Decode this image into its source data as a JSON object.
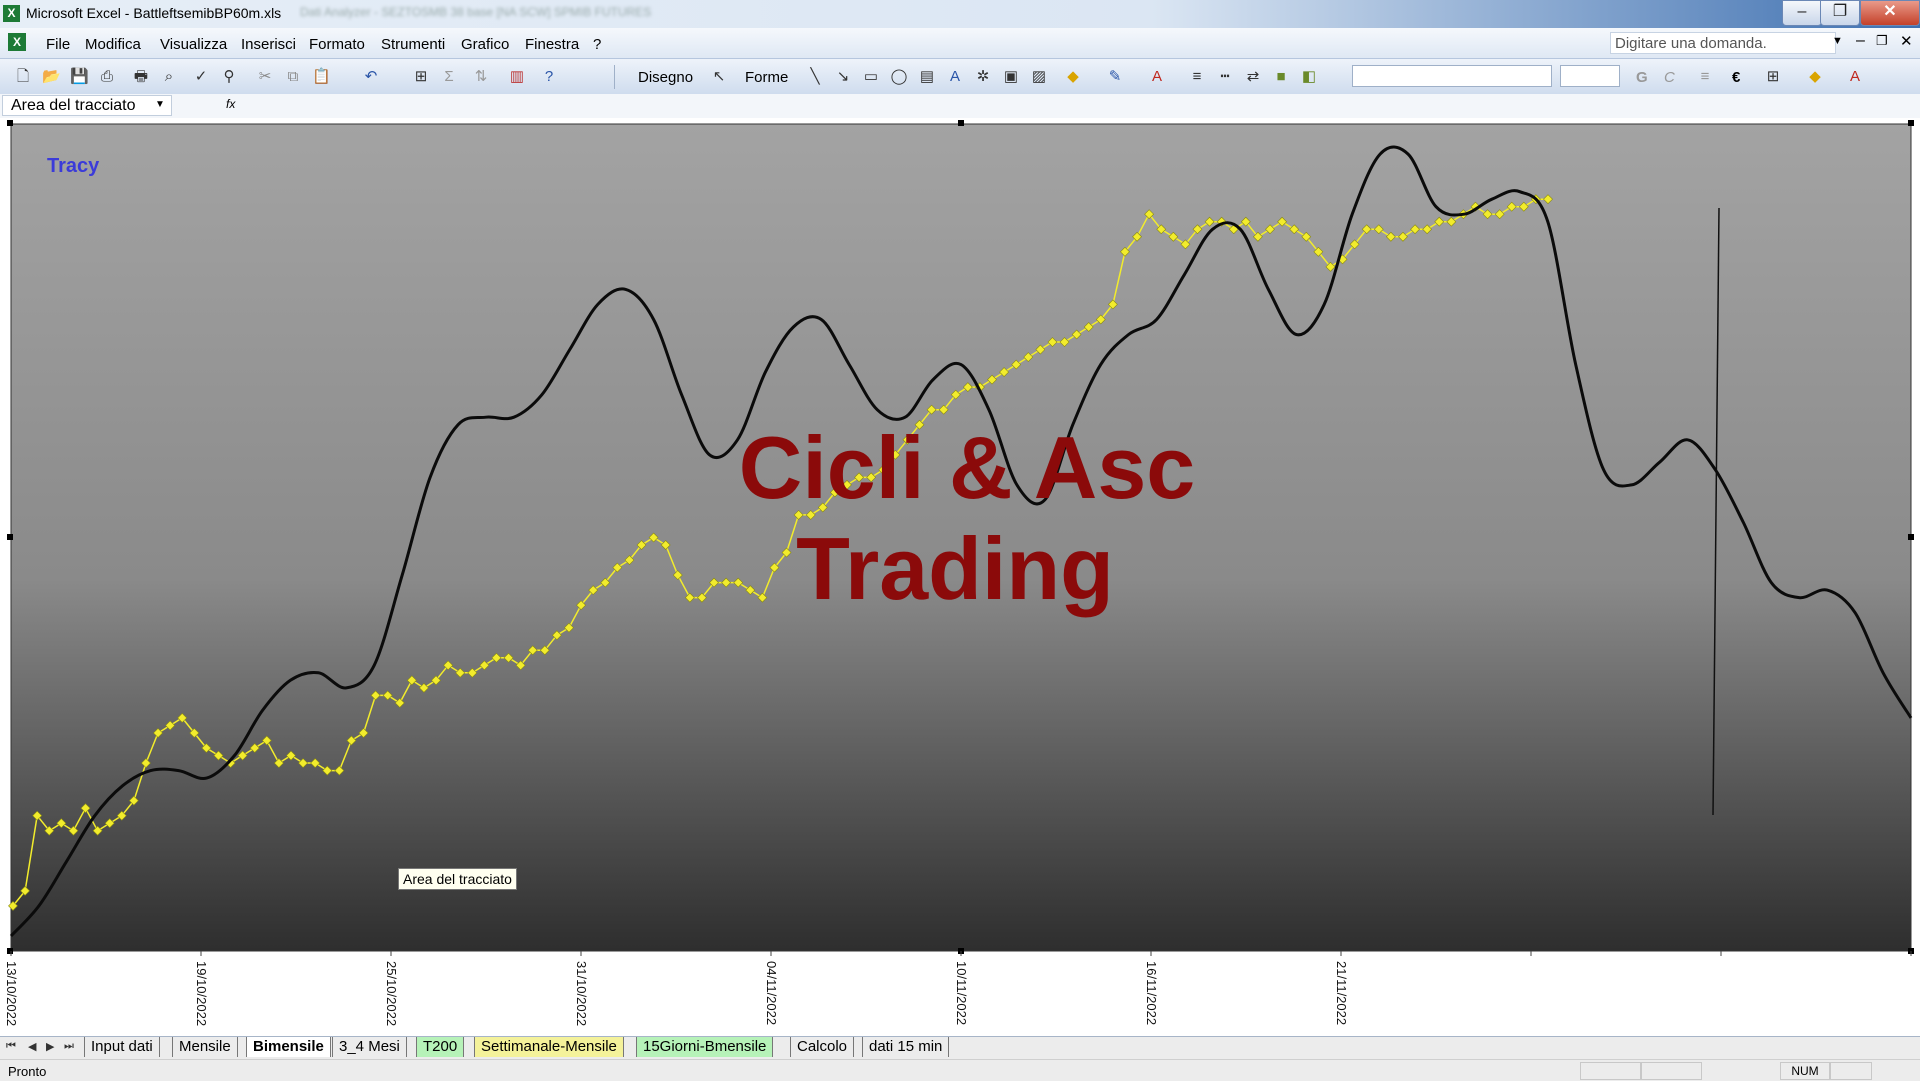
{
  "window": {
    "title": "Microsoft Excel - BattleftsemibBP60m.xls",
    "blurred_title_suffix": "Dati Analyzer - SEZTOSMB 38 base [NA SCW] SPMIB FUTURES",
    "minimize": "–",
    "restore": "❐",
    "close": "✕"
  },
  "menu": {
    "items": [
      "File",
      "Modifica",
      "Visualizza",
      "Inserisci",
      "Formato",
      "Strumenti",
      "Grafico",
      "Finestra",
      "?"
    ],
    "help_placeholder": "Digitare una domanda."
  },
  "toolbar": {
    "disegno_label": "Disegno",
    "forme_label": "Forme",
    "bold_label": "G",
    "italic_label": "C",
    "euro_label": "€"
  },
  "formula_bar": {
    "name_box": "Area del tracciato",
    "fx": "fx"
  },
  "chart": {
    "tooltip": "Area del tracciato",
    "tracy_label": "Tracy",
    "watermark_line1": "Cicli & Asc",
    "watermark_line2": "Trading",
    "colors": {
      "background_top": "#a3a3a3",
      "background_bottom": "#2e2e2e",
      "price_line": "#f2ec2c",
      "cycle_line": "#0b0b0b",
      "watermark": "#8b0a0a",
      "tracy": "#3b3bd9"
    }
  },
  "chart_data": {
    "type": "line",
    "x_tick_labels": [
      "13/10/2022",
      "19/10/2022",
      "25/10/2022",
      "31/10/2022",
      "04/11/2022",
      "10/11/2022",
      "16/11/2022",
      "21/11/2022",
      "",
      ""
    ],
    "series": [
      {
        "name": "Tracy",
        "style": "yellow line with diamond markers",
        "values": [
          6,
          8,
          18,
          16,
          17,
          16,
          19,
          16,
          17,
          18,
          20,
          25,
          29,
          30,
          31,
          29,
          27,
          26,
          25,
          26,
          27,
          28,
          25,
          26,
          25,
          25,
          24,
          24,
          28,
          29,
          34,
          34,
          33,
          36,
          35,
          36,
          38,
          37,
          37,
          38,
          39,
          39,
          38,
          40,
          40,
          42,
          43,
          46,
          48,
          49,
          51,
          52,
          54,
          55,
          54,
          50,
          47,
          47,
          49,
          49,
          49,
          48,
          47,
          51,
          53,
          58,
          58,
          59,
          61,
          62,
          63,
          63,
          64,
          66,
          68,
          70,
          72,
          72,
          74,
          75,
          75,
          76,
          77,
          78,
          79,
          80,
          81,
          81,
          82,
          83,
          84,
          86,
          93,
          95,
          98,
          96,
          95,
          94,
          96,
          97,
          97,
          96,
          97,
          95,
          96,
          97,
          96,
          95,
          93,
          91,
          92,
          94,
          96,
          96,
          95,
          95,
          96,
          96,
          97,
          97,
          98,
          99,
          98,
          98,
          99,
          99,
          100,
          100
        ]
      },
      {
        "name": "",
        "style": "black smooth cycle line",
        "values": [
          2,
          6,
          12,
          18,
          22,
          24,
          24,
          23,
          26,
          32,
          36,
          37,
          35,
          38,
          50,
          63,
          70,
          71,
          71,
          74,
          80,
          86,
          88,
          84,
          74,
          66,
          68,
          77,
          83,
          84,
          78,
          72,
          71,
          76,
          78,
          72,
          62,
          60,
          70,
          78,
          82,
          84,
          90,
          96,
          96,
          88,
          82,
          86,
          98,
          106,
          106,
          99,
          98,
          100,
          101,
          97,
          78,
          64,
          62,
          65,
          68,
          64,
          57,
          49,
          47,
          48,
          45,
          37,
          31
        ]
      }
    ],
    "ylim": [
      0,
      110
    ],
    "grid": false,
    "legend": "none"
  },
  "sheet_tabs": {
    "nav": [
      "⏮",
      "◀",
      "▶",
      "⏭"
    ],
    "tabs": [
      {
        "label": "Input dati",
        "color": "#ececec",
        "bold": false
      },
      {
        "label": "Mensile",
        "color": "#ececec",
        "bold": false
      },
      {
        "label": "Bimensile",
        "color": "#ffffff",
        "bold": true
      },
      {
        "label": "3_4 Mesi",
        "color": "#ececec",
        "bold": false
      },
      {
        "label": "T200",
        "color": "#b6f2b8",
        "bold": false
      },
      {
        "label": "Settimanale-Mensile",
        "color": "#f4f29a",
        "bold": false
      },
      {
        "label": "15Giorni-Bmensile",
        "color": "#b6f2b8",
        "bold": false
      },
      {
        "label": "Calcolo",
        "color": "#ececec",
        "bold": false
      },
      {
        "label": "dati 15 min",
        "color": "#ececec",
        "bold": false
      }
    ]
  },
  "status": {
    "text": "Pronto",
    "num": "NUM"
  }
}
